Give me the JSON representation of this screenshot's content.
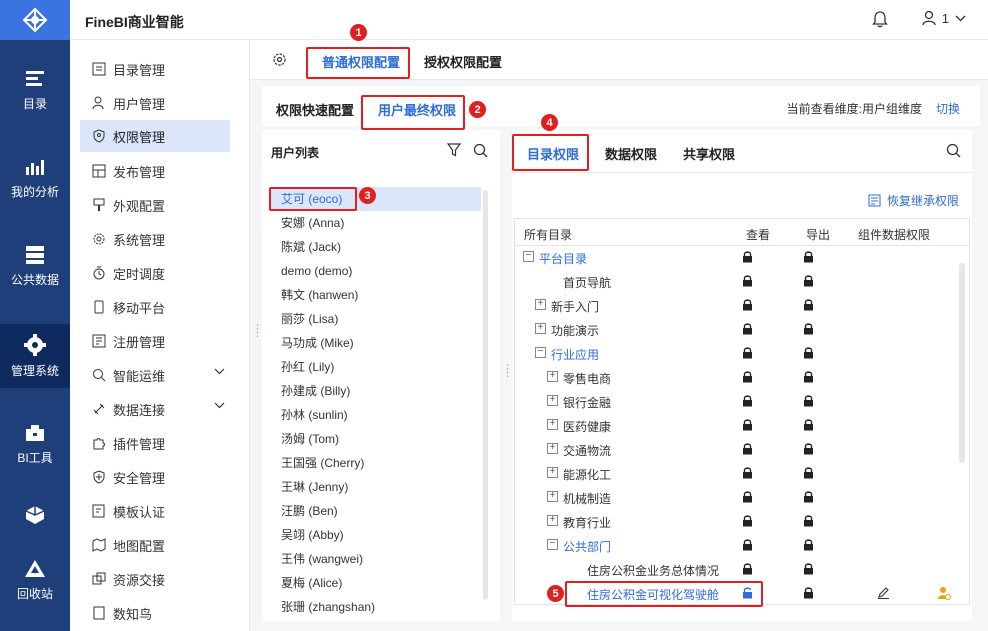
{
  "app": {
    "title": "FineBI商业智能",
    "user": "1"
  },
  "leftnav": [
    {
      "label": "目录",
      "icon": "catalog-icon"
    },
    {
      "label": "我的分析",
      "icon": "analysis-icon"
    },
    {
      "label": "公共数据",
      "icon": "public-data-icon"
    },
    {
      "label": "管理系统",
      "icon": "admin-gear-icon"
    },
    {
      "label": "BI工具",
      "icon": "toolbox-icon"
    },
    {
      "label": "",
      "icon": "cube-icon"
    },
    {
      "label": "回收站",
      "icon": "recycle-icon"
    }
  ],
  "menu": [
    "目录管理",
    "用户管理",
    "权限管理",
    "发布管理",
    "外观配置",
    "系统管理",
    "定时调度",
    "移动平台",
    "注册管理",
    "智能运维",
    "数据连接",
    "插件管理",
    "安全管理",
    "模板认证",
    "地图配置",
    "资源交接",
    "数知鸟"
  ],
  "tabs": {
    "general": "普通权限配置",
    "grant": "授权权限配置"
  },
  "subtabs": {
    "quick": "权限快速配置",
    "final": "用户最终权限",
    "dimension": "当前查看维度:用户组维度",
    "switch": "切换"
  },
  "users": {
    "title": "用户列表",
    "list": [
      "艾可 (eoco)",
      "安娜 (Anna)",
      "陈斌 (Jack)",
      "demo (demo)",
      "韩文 (hanwen)",
      "丽莎 (Lisa)",
      "马功成 (Mike)",
      "孙红 (Lily)",
      "孙建成 (Billy)",
      "孙林 (sunlin)",
      "汤姆 (Tom)",
      "王国强 (Cherry)",
      "王琳 (Jenny)",
      "汪鹏 (Ben)",
      "吴翊 (Abby)",
      "王伟 (wangwei)",
      "夏梅 (Alice)",
      "张珊 (zhangshan)"
    ]
  },
  "perm_tabs": {
    "catalog": "目录权限",
    "data": "数据权限",
    "share": "共享权限",
    "restore": "恢复继承权限"
  },
  "table": {
    "headers": {
      "all": "所有目录",
      "view": "查看",
      "export": "导出",
      "component": "组件数据权限"
    },
    "rows": [
      {
        "name": "平台目录",
        "expander": "minus"
      },
      {
        "name": "首页导航",
        "expander": ""
      },
      {
        "name": "新手入门",
        "expander": "plus"
      },
      {
        "name": "功能演示",
        "expander": "plus"
      },
      {
        "name": "行业应用",
        "expander": "minus"
      },
      {
        "name": "零售电商",
        "expander": "plus"
      },
      {
        "name": "银行金融",
        "expander": "plus"
      },
      {
        "name": "医药健康",
        "expander": "plus"
      },
      {
        "name": "交通物流",
        "expander": "plus"
      },
      {
        "name": "能源化工",
        "expander": "plus"
      },
      {
        "name": "机械制造",
        "expander": "plus"
      },
      {
        "name": "教育行业",
        "expander": "plus"
      },
      {
        "name": "公共部门",
        "expander": "minus"
      },
      {
        "name": "住房公积金业务总体情况",
        "expander": ""
      },
      {
        "name": "住房公积金可视化驾驶舱",
        "expander": ""
      }
    ]
  },
  "markers": [
    "1",
    "2",
    "3",
    "4",
    "5"
  ],
  "colors": {
    "accent": "#2f6bd9",
    "highlight": "#e02020",
    "nav": "#1f3f7a"
  }
}
